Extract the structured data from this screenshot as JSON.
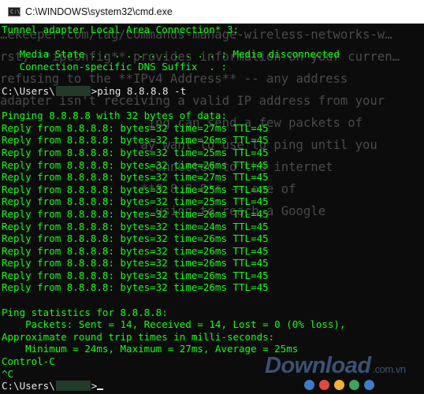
{
  "window": {
    "title": "C:\\WINDOWS\\system32\\cmd.exe",
    "icon_label": "C:\\_"
  },
  "background_text": [
    "…ekeeper.com/tag/commands-manage-wireless-networks-w…",
    "rst, **ipconfig** provides information on your curren…",
    "refusing to the **IPv4 Address** -- any address",
    "adapter isn't receiving a valid IP address from your",
    "                    ing can send a few packets of",
    "                   ay want to use to ping until you",
    "                    connected to the internet",
    "                   **8.8.8.8** -- one of",
    "                     using to reach a Google"
  ],
  "console": {
    "lines": [
      {
        "text": "Tunnel adapter Local Area Connection* 3:"
      },
      {
        "text": ""
      },
      {
        "text": "   Media State . . . . . . . . . . . : Media disconnected"
      },
      {
        "text": "   Connection-specific DNS Suffix  . :"
      },
      {
        "text": ""
      },
      {
        "prompt_prefix": "C:\\Users\\",
        "prompt_suffix": ">ping 8.8.8.8 -t"
      },
      {
        "text": ""
      },
      {
        "text": "Pinging 8.8.8.8 with 32 bytes of data:"
      },
      {
        "text": "Reply from 8.8.8.8: bytes=32 time=27ms TTL=45"
      },
      {
        "text": "Reply from 8.8.8.8: bytes=32 time=26ms TTL=45"
      },
      {
        "text": "Reply from 8.8.8.8: bytes=32 time=25ms TTL=45"
      },
      {
        "text": "Reply from 8.8.8.8: bytes=32 time=26ms TTL=45"
      },
      {
        "text": "Reply from 8.8.8.8: bytes=32 time=27ms TTL=45"
      },
      {
        "text": "Reply from 8.8.8.8: bytes=32 time=25ms TTL=45"
      },
      {
        "text": "Reply from 8.8.8.8: bytes=32 time=25ms TTL=45"
      },
      {
        "text": "Reply from 8.8.8.8: bytes=32 time=26ms TTL=45"
      },
      {
        "text": "Reply from 8.8.8.8: bytes=32 time=24ms TTL=45"
      },
      {
        "text": "Reply from 8.8.8.8: bytes=32 time=26ms TTL=45"
      },
      {
        "text": "Reply from 8.8.8.8: bytes=32 time=26ms TTL=45"
      },
      {
        "text": "Reply from 8.8.8.8: bytes=32 time=26ms TTL=45"
      },
      {
        "text": "Reply from 8.8.8.8: bytes=32 time=26ms TTL=45"
      },
      {
        "text": "Reply from 8.8.8.8: bytes=32 time=26ms TTL=45"
      },
      {
        "text": ""
      },
      {
        "text": "Ping statistics for 8.8.8.8:"
      },
      {
        "text": "    Packets: Sent = 14, Received = 14, Lost = 0 (0% loss),"
      },
      {
        "text": "Approximate round trip times in milli-seconds:"
      },
      {
        "text": "    Minimum = 24ms, Maximum = 27ms, Average = 25ms"
      },
      {
        "text": "Control-C"
      },
      {
        "text": "^C"
      },
      {
        "prompt_prefix": "C:\\Users\\",
        "prompt_suffix": ">",
        "cursor": true
      }
    ]
  },
  "watermark": {
    "brand": "Download",
    "domain": ".com.vn",
    "dot_colors": [
      "#3d7cc9",
      "#e04a3f",
      "#f2b233",
      "#3ba55c",
      "#3d7cc9"
    ]
  },
  "colors": {
    "console_background": "#0c0c0c",
    "console_text": "#13ff13",
    "prompt_text": "#e8e8e8",
    "titlebar": "#ffffff"
  }
}
